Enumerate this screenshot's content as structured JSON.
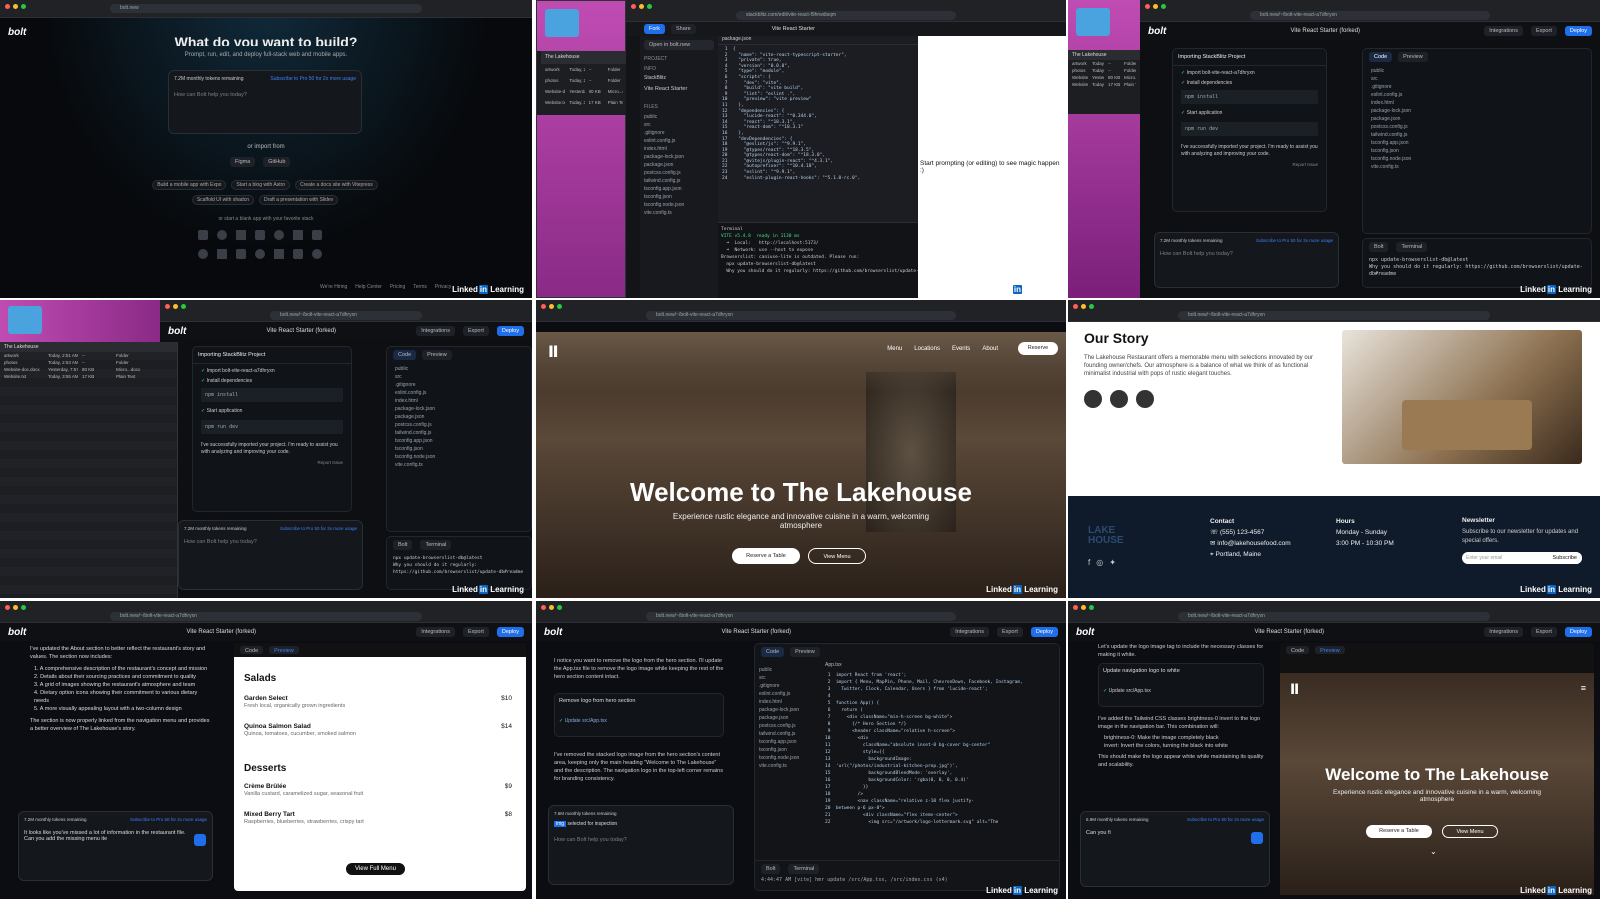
{
  "brand": "bolt",
  "linkedin": {
    "word": "Linked",
    "in": "in",
    "suffix": " Learning"
  },
  "tile1": {
    "headline": "What do you want to build?",
    "sub": "Prompt, run, edit, and deploy full-stack web and mobile apps.",
    "tokens": "7.2M monthly tokens remaining",
    "subscribe": "Subscribe to Pro 50 for 2x more usage",
    "placeholder": "How can Bolt help you today?",
    "import_label": "or import from",
    "figma": "Figma",
    "github": "GitHub",
    "examples": [
      "Build a mobile app with Expo",
      "Start a blog with Astro",
      "Create a docs site with Vitepress",
      "Scaffold UI with shadcn",
      "Draft a presentation with Slidev"
    ],
    "stack_label": "or start a blank app with your favorite stack",
    "footer": [
      "We're Hiring",
      "Help Center",
      "Pricing",
      "Terms",
      "Privacy"
    ]
  },
  "tile2": {
    "tabs": [
      "Fork",
      "Share"
    ],
    "title": "Vite React Starter",
    "url": "stackblitz.com/edit/vite-react-f9hrwdisqm",
    "open_btn": "Open in bolt.new",
    "file": "package.json",
    "project_label": "PROJECT",
    "info_label": "INFO",
    "owner": "StackBlitz",
    "proj_name": "Vite React Starter",
    "files_label": "FILES",
    "code": [
      "{",
      "  \"name\": \"vite-react-typescript-starter\",",
      "  \"private\": true,",
      "  \"version\": \"0.0.0\",",
      "  \"type\": \"module\",",
      "  \"scripts\": {",
      "    \"dev\": \"vite\",",
      "    \"build\": \"vite build\",",
      "    \"lint\": \"eslint .\",",
      "    \"preview\": \"vite preview\"",
      "  },",
      "  \"dependencies\": {",
      "    \"lucide-react\": \"^0.344.0\",",
      "    \"react\": \"^18.3.1\",",
      "    \"react-dom\": \"^18.3.1\"",
      "  },",
      "  \"devDependencies\": {",
      "    \"@eslint/js\": \"^9.9.1\",",
      "    \"@types/react\": \"^18.3.5\",",
      "    \"@types/react-dom\": \"^18.3.0\",",
      "    \"@vitejs/plugin-react\": \"^4.3.1\",",
      "    \"autoprefixer\": \"^10.4.18\",",
      "    \"eslint\": \"^9.9.1\",",
      "    \"eslint-plugin-react-hooks\": \"^5.1.0-rc.0\","
    ],
    "terminal": [
      "Terminal",
      "VITE v5.4.8  ready in 1130 ms",
      "  ➜  Local:   http://localhost:5173/",
      "  ➜  Network: use --host to expose",
      "Browserslist: caniuse-lite is outdated. Please run:",
      "  npx update-browserslist-db@latest",
      "  Why you should do it regularly: https://github.com/browserslist/update-db#readme"
    ],
    "preview_msg": "Start prompting (or editing) to see magic happen :)"
  },
  "import_panel": {
    "title": "Importing StackBlitz Project",
    "step1": "Import bolt-vite-react-a7dhryxn",
    "step2": "Install dependencies",
    "cmd1": "npm install",
    "step3": "Start application",
    "cmd2": "npm run dev",
    "msg": "I've successfully imported your project. I'm ready to assist you with analyzing and improving your code.",
    "report": "Report Issue",
    "tokens": "7.2M monthly tokens remaining",
    "subscribe": "Subscribe to Pro 50 for 2x more usage",
    "placeholder": "How can Bolt help you today?",
    "tabs": [
      "Code",
      "Preview"
    ],
    "files": [
      "public",
      "src",
      ".gitignore",
      "eslint.config.js",
      "index.html",
      "package-lock.json",
      "package.json",
      "postcss.config.js",
      "tailwind.config.js",
      "tsconfig.app.json",
      "tsconfig.json",
      "tsconfig.node.json",
      "vite.config.ts"
    ],
    "terminal_tabs": [
      "Bolt",
      "Terminal"
    ],
    "term": "npx update-browserslist-db@latest\nWhy you should do it regularly: https://github.com/browserslist/update-db#readme"
  },
  "header": {
    "project": "Vite React Starter (forked)",
    "integrations": "Integrations",
    "export": "Export",
    "deploy": "Deploy"
  },
  "finder": {
    "title": "The Lakehouse",
    "cols": [
      "Name",
      "Date Modified",
      "Size",
      "Kind"
    ],
    "rows": [
      [
        "artwork",
        "Today, 2:51 AM",
        "--",
        "Folder"
      ],
      [
        "photos",
        "Today, 2:53 AM",
        "--",
        "Folder"
      ],
      [
        "Website-doc.docx",
        "Yesterday, 7:57 PM",
        "80 KB",
        "Micro...docx"
      ],
      [
        "Website.txt",
        "Today, 3:55 AM",
        "17 KB",
        "Plain Text"
      ]
    ]
  },
  "lakehouse": {
    "nav": [
      "Menu",
      "Locations",
      "Events",
      "About"
    ],
    "reserve": "Reserve",
    "title": "Welcome to The Lakehouse",
    "sub": "Experience rustic elegance and innovative cuisine in a warm, welcoming atmosphere",
    "btn1": "Reserve a Table",
    "btn2": "View Menu"
  },
  "story": {
    "title": "Our Story",
    "body": "The Lakehouse Restaurant offers a memorable menu with selections innovated by our founding owner/chefs. Our atmosphere is a balance of what we think of as functional minimalist industrial with pops of rustic elegant touches.",
    "contact_h": "Contact",
    "phone": "(555) 123-4567",
    "email": "info@lakehousefood.com",
    "city": "Portland, Maine",
    "hours_h": "Hours",
    "days": "Monday - Sunday",
    "time": "3:00 PM - 10:30 PM",
    "news_h": "Newsletter",
    "news_body": "Subscribe to our newsletter for updates and special offers.",
    "news_ph": "Enter your email",
    "subscribe": "Subscribe",
    "logo": "LAKE HOUSE"
  },
  "tile7": {
    "intro": "I've updated the About section to better reflect the restaurant's story and values. The section now includes:",
    "points": [
      "1. A comprehensive description of the restaurant's concept and mission",
      "2. Details about their sourcing practices and commitment to quality",
      "3. A grid of images showing the restaurant's atmosphere and team",
      "4. Dietary option icons showing their commitment to various dietary needs",
      "5. A more visually appealing layout with a two-column design"
    ],
    "outro": "The section is now properly linked from the navigation menu and provides a better overview of The Lakehouse's story.",
    "tokens": "7.2M monthly tokens remaining",
    "subscribe": "Subscribe to Pro 50 for 2x more usage",
    "input": "It looks like you've missed a lot of information in the restaurant file. Can you add the missing menu ite",
    "salads": "Salads",
    "desserts": "Desserts",
    "items": [
      {
        "name": "Garden Select",
        "desc": "Fresh local, organically grown ingredients",
        "price": "$10"
      },
      {
        "name": "Quinoa Salmon Salad",
        "desc": "Quinoa, tomatoes, cucumber, smoked salmon",
        "price": "$14"
      },
      {
        "name": "Crème Brûlée",
        "desc": "Vanilla custard, caramelized sugar, seasonal fruit",
        "price": "$9"
      },
      {
        "name": "Mixed Berry Tart",
        "desc": "Raspberries, blueberries, strawberries, crispy tart",
        "price": "$8"
      }
    ],
    "full_menu": "View Full Menu"
  },
  "tile8": {
    "intro": "I notice you want to remove the logo from the hero section. I'll update the App.tsx file to remove the logo image while keeping the rest of the hero section content intact.",
    "action": "Remove logo from hero section",
    "update": "Update src/App.tsx",
    "msg": "I've removed the stacked logo image from the hero section's content area, keeping only the main heading \"Welcome to The Lakehouse\" and the description. The navigation logo in the top-left corner remains for branding consistency.",
    "tokens": "7.6M monthly tokens remaining",
    "selected": "selected for inspection",
    "placeholder": "How can Bolt help you today?",
    "file": "App.tsx",
    "code": [
      "import React from 'react';",
      "import { Menu, MapPin, Phone, Mail, ChevronDown, Facebook, Instagram,",
      "  Twitter, Clock, Calendar, Users } from 'lucide-react';",
      "",
      "function App() {",
      "  return (",
      "    <div className=\"min-h-screen bg-white\">",
      "      {/* Hero Section */}",
      "      <header className=\"relative h-screen\">",
      "        <div",
      "          className=\"absolute inset-0 bg-cover bg-center\"",
      "          style={{",
      "            backgroundImage:",
      "'url(\"/photos/industrial-kitchen-prep.jpg\")',",
      "            backgroundBlendMode: 'overlay',",
      "            backgroundColor: 'rgba(0, 0, 0, 0.4)'",
      "          }}",
      "        />",
      "        <nav className=\"relative z-10 flex justify-",
      "between p-6 px-8\">",
      "          <div className=\"flex items-center\">",
      "            <img src=\"/artwork/logo-lettermark.svg\" alt=\"The"
    ],
    "term": "4:44:47 AM [vite] hmr update /src/App.tsx, /src/index.css (x4)"
  },
  "tile9": {
    "intro": "Let's update the logo image tag to include the necessary classes for making it white.",
    "action": "Update navigation logo to white",
    "update": "Update src/App.tsx",
    "msg": "I've added the Tailwind CSS classes brightness-0 invert to the logo image in the navigation bar. This combination will:",
    "b1": "brightness-0: Make the image completely black",
    "b2": "invert: Invert the colors, turning the black into white",
    "msg2": "This should make the logo appear white while maintaining its quality and scalability.",
    "tokens": "6.9M monthly tokens remaining",
    "input": "Can you fi"
  }
}
